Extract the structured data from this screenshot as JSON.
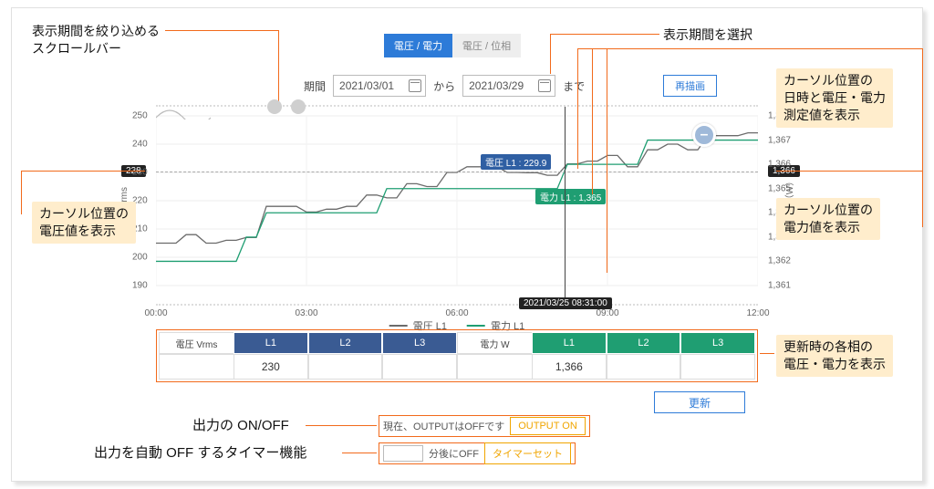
{
  "tabs": {
    "voltage_power": "電圧 / 電力",
    "voltage_phase": "電圧 / 位相"
  },
  "period": {
    "label": "期間",
    "from": "2021/03/01",
    "to_word": "から",
    "to": "2021/03/29",
    "until": "まで",
    "redraw": "再描画"
  },
  "annotations": {
    "scrollbar": "表示期間を絞り込める\nスクロールバー",
    "select_period": "表示期間を選択",
    "cursor_all": "カーソル位置の\n日時と電圧・電力\n測定値を表示",
    "cursor_v": "カーソル位置の\n電圧値を表示",
    "cursor_w": "カーソル位置の\n電力値を表示",
    "phase_table": "更新時の各相の\n電圧・電力を表示",
    "output_onoff": "出力の ON/OFF",
    "timer": "出力を自動 OFF するタイマー機能"
  },
  "chart_data": {
    "type": "line",
    "x": [
      "00:00",
      "03:00",
      "06:00",
      "09:00",
      "12:00"
    ],
    "cursor_time": "2021/03/25 08:31:00",
    "series": [
      {
        "name": "電圧 L1",
        "axis": "left",
        "color": "#6b6b6b",
        "values": [
          205,
          205,
          208,
          205,
          206,
          207,
          218,
          218,
          216,
          217,
          218,
          222,
          221,
          226,
          225,
          230,
          232,
          232,
          230,
          229.9,
          229,
          233,
          234,
          236,
          232,
          238,
          240,
          238,
          243,
          243,
          244
        ]
      },
      {
        "name": "電力 L1",
        "axis": "right",
        "color": "#1f9e72",
        "values": [
          1362,
          1362,
          1362,
          1362,
          1362,
          1363,
          1364,
          1364,
          1364,
          1364,
          1364,
          1364,
          1365,
          1365,
          1365,
          1365,
          1365,
          1365,
          1365,
          1365,
          1365,
          1366,
          1366,
          1366,
          1366,
          1367,
          1367,
          1367,
          1367,
          1367,
          1367
        ]
      }
    ],
    "yleft": {
      "label": "Vrms",
      "min": 190,
      "max": 250,
      "ticks": [
        190,
        200,
        210,
        220,
        230,
        240,
        250
      ]
    },
    "yright": {
      "label": "電力（W）",
      "min": 1361,
      "max": 1368,
      "ticks": [
        1361,
        1362,
        1363,
        1364,
        1365,
        1366,
        1367,
        1368
      ]
    },
    "left_flag": "228",
    "right_flag": "1,366",
    "tooltip_v": "電圧 L1 : 229.9",
    "tooltip_w": "電力 L1 : 1,365",
    "legend": [
      "電圧 L1",
      "電力 L1"
    ]
  },
  "phase": {
    "v_label": "電圧 Vrms",
    "w_label": "電力 W",
    "cols": [
      "L1",
      "L2",
      "L3"
    ],
    "v_vals": [
      "230",
      "",
      ""
    ],
    "w_vals": [
      "1,366",
      "",
      ""
    ],
    "update": "更新"
  },
  "output": {
    "status": "現在、OUTPUTはOFFです",
    "button": "OUTPUT ON"
  },
  "timer": {
    "suffix": "分後にOFF",
    "button": "タイマーセット"
  }
}
